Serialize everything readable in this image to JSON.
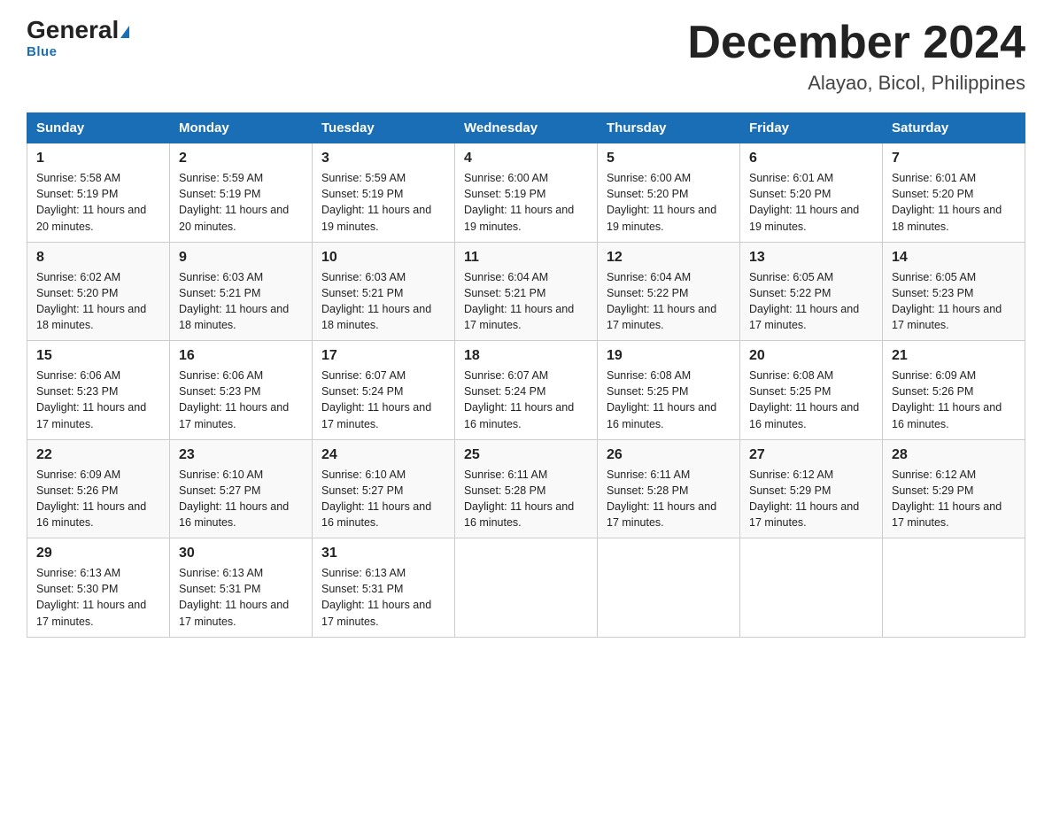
{
  "logo": {
    "name": "General",
    "name2": "Blue"
  },
  "title": "December 2024",
  "subtitle": "Alayao, Bicol, Philippines",
  "days_of_week": [
    "Sunday",
    "Monday",
    "Tuesday",
    "Wednesday",
    "Thursday",
    "Friday",
    "Saturday"
  ],
  "weeks": [
    [
      {
        "day": "1",
        "sunrise": "5:58 AM",
        "sunset": "5:19 PM",
        "daylight": "11 hours and 20 minutes."
      },
      {
        "day": "2",
        "sunrise": "5:59 AM",
        "sunset": "5:19 PM",
        "daylight": "11 hours and 20 minutes."
      },
      {
        "day": "3",
        "sunrise": "5:59 AM",
        "sunset": "5:19 PM",
        "daylight": "11 hours and 19 minutes."
      },
      {
        "day": "4",
        "sunrise": "6:00 AM",
        "sunset": "5:19 PM",
        "daylight": "11 hours and 19 minutes."
      },
      {
        "day": "5",
        "sunrise": "6:00 AM",
        "sunset": "5:20 PM",
        "daylight": "11 hours and 19 minutes."
      },
      {
        "day": "6",
        "sunrise": "6:01 AM",
        "sunset": "5:20 PM",
        "daylight": "11 hours and 19 minutes."
      },
      {
        "day": "7",
        "sunrise": "6:01 AM",
        "sunset": "5:20 PM",
        "daylight": "11 hours and 18 minutes."
      }
    ],
    [
      {
        "day": "8",
        "sunrise": "6:02 AM",
        "sunset": "5:20 PM",
        "daylight": "11 hours and 18 minutes."
      },
      {
        "day": "9",
        "sunrise": "6:03 AM",
        "sunset": "5:21 PM",
        "daylight": "11 hours and 18 minutes."
      },
      {
        "day": "10",
        "sunrise": "6:03 AM",
        "sunset": "5:21 PM",
        "daylight": "11 hours and 18 minutes."
      },
      {
        "day": "11",
        "sunrise": "6:04 AM",
        "sunset": "5:21 PM",
        "daylight": "11 hours and 17 minutes."
      },
      {
        "day": "12",
        "sunrise": "6:04 AM",
        "sunset": "5:22 PM",
        "daylight": "11 hours and 17 minutes."
      },
      {
        "day": "13",
        "sunrise": "6:05 AM",
        "sunset": "5:22 PM",
        "daylight": "11 hours and 17 minutes."
      },
      {
        "day": "14",
        "sunrise": "6:05 AM",
        "sunset": "5:23 PM",
        "daylight": "11 hours and 17 minutes."
      }
    ],
    [
      {
        "day": "15",
        "sunrise": "6:06 AM",
        "sunset": "5:23 PM",
        "daylight": "11 hours and 17 minutes."
      },
      {
        "day": "16",
        "sunrise": "6:06 AM",
        "sunset": "5:23 PM",
        "daylight": "11 hours and 17 minutes."
      },
      {
        "day": "17",
        "sunrise": "6:07 AM",
        "sunset": "5:24 PM",
        "daylight": "11 hours and 17 minutes."
      },
      {
        "day": "18",
        "sunrise": "6:07 AM",
        "sunset": "5:24 PM",
        "daylight": "11 hours and 16 minutes."
      },
      {
        "day": "19",
        "sunrise": "6:08 AM",
        "sunset": "5:25 PM",
        "daylight": "11 hours and 16 minutes."
      },
      {
        "day": "20",
        "sunrise": "6:08 AM",
        "sunset": "5:25 PM",
        "daylight": "11 hours and 16 minutes."
      },
      {
        "day": "21",
        "sunrise": "6:09 AM",
        "sunset": "5:26 PM",
        "daylight": "11 hours and 16 minutes."
      }
    ],
    [
      {
        "day": "22",
        "sunrise": "6:09 AM",
        "sunset": "5:26 PM",
        "daylight": "11 hours and 16 minutes."
      },
      {
        "day": "23",
        "sunrise": "6:10 AM",
        "sunset": "5:27 PM",
        "daylight": "11 hours and 16 minutes."
      },
      {
        "day": "24",
        "sunrise": "6:10 AM",
        "sunset": "5:27 PM",
        "daylight": "11 hours and 16 minutes."
      },
      {
        "day": "25",
        "sunrise": "6:11 AM",
        "sunset": "5:28 PM",
        "daylight": "11 hours and 16 minutes."
      },
      {
        "day": "26",
        "sunrise": "6:11 AM",
        "sunset": "5:28 PM",
        "daylight": "11 hours and 17 minutes."
      },
      {
        "day": "27",
        "sunrise": "6:12 AM",
        "sunset": "5:29 PM",
        "daylight": "11 hours and 17 minutes."
      },
      {
        "day": "28",
        "sunrise": "6:12 AM",
        "sunset": "5:29 PM",
        "daylight": "11 hours and 17 minutes."
      }
    ],
    [
      {
        "day": "29",
        "sunrise": "6:13 AM",
        "sunset": "5:30 PM",
        "daylight": "11 hours and 17 minutes."
      },
      {
        "day": "30",
        "sunrise": "6:13 AM",
        "sunset": "5:31 PM",
        "daylight": "11 hours and 17 minutes."
      },
      {
        "day": "31",
        "sunrise": "6:13 AM",
        "sunset": "5:31 PM",
        "daylight": "11 hours and 17 minutes."
      },
      null,
      null,
      null,
      null
    ]
  ]
}
